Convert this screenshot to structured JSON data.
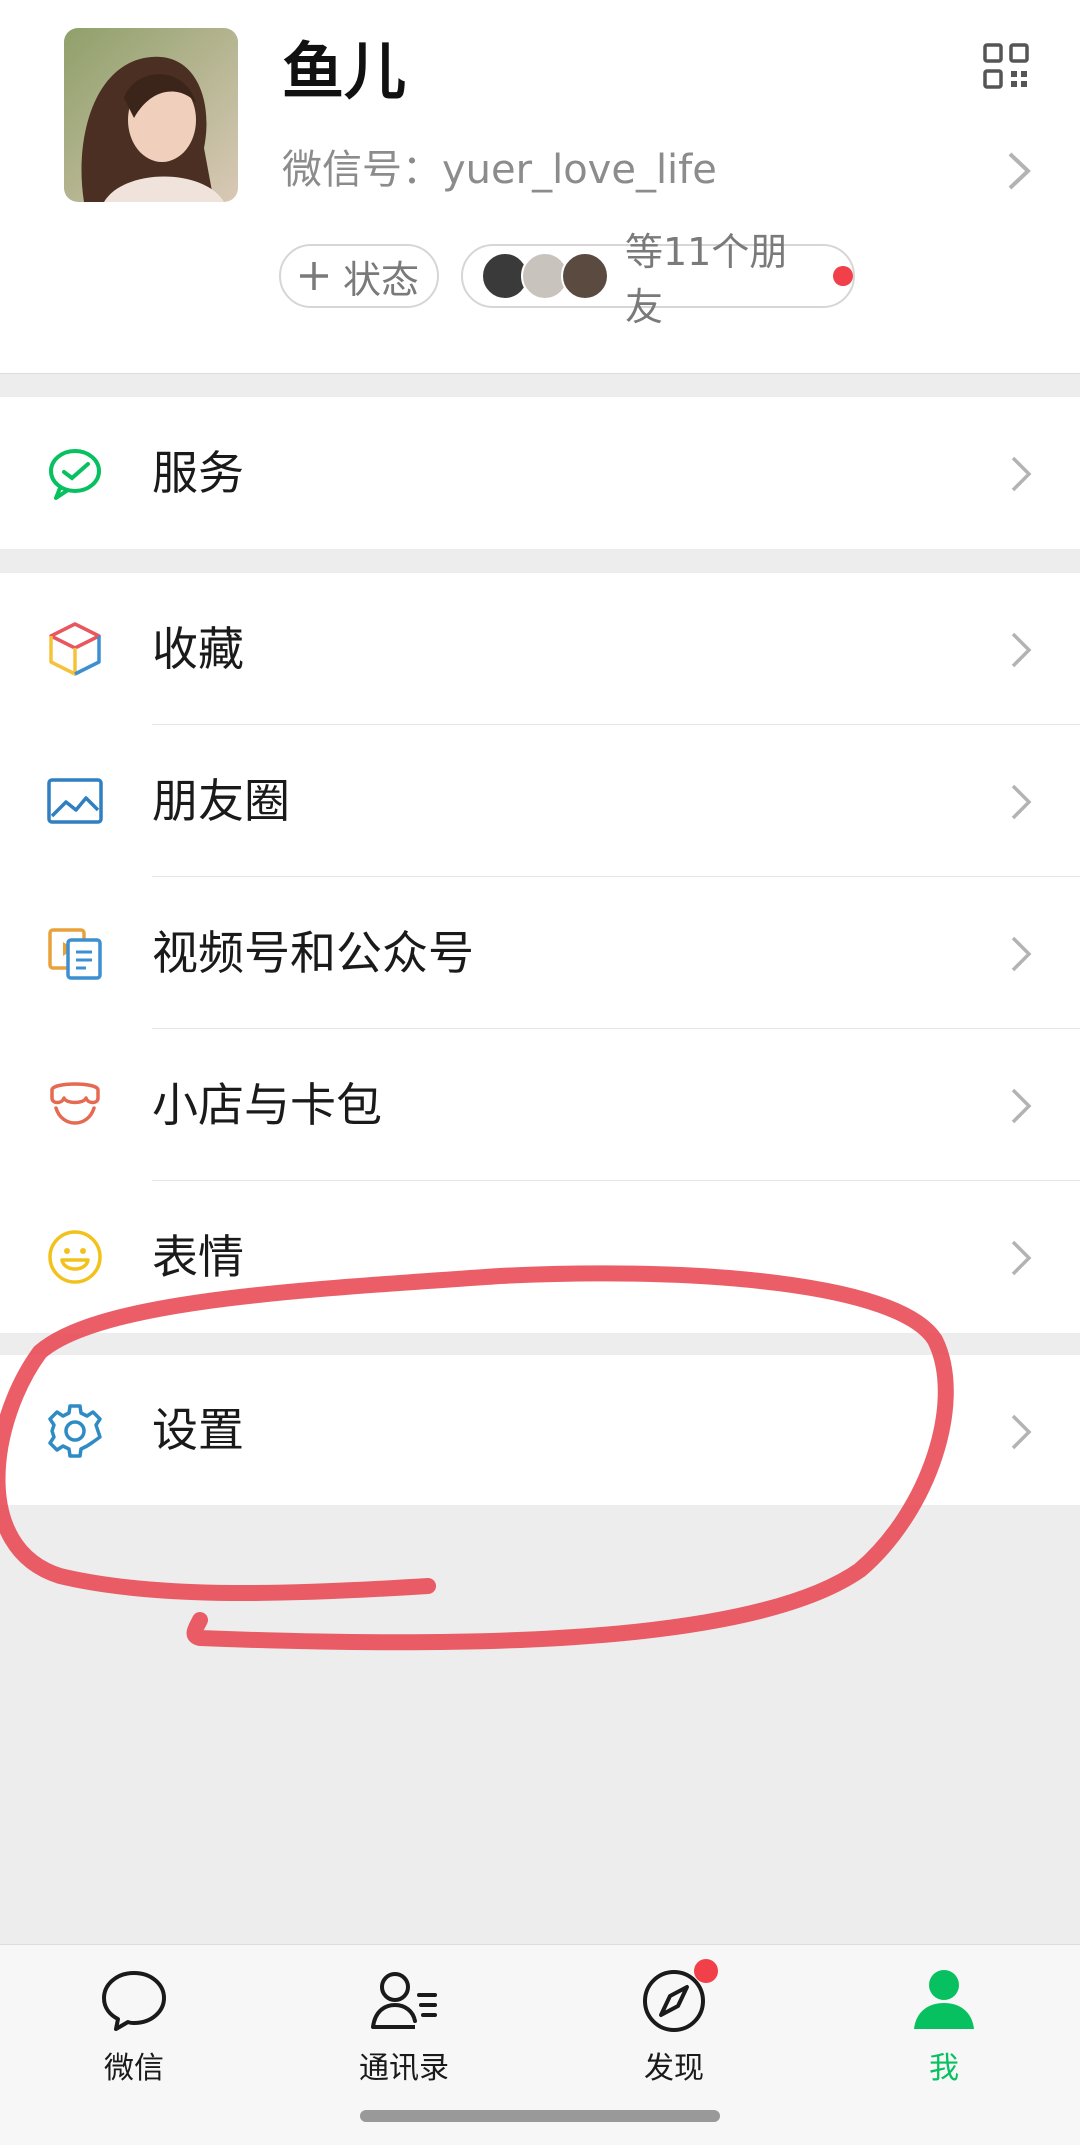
{
  "profile": {
    "name": "鱼儿",
    "wechat_id": "微信号：yuer_love_life",
    "status_button": "状态",
    "friends_text": "等11个朋友"
  },
  "menu": {
    "services": "服务",
    "favorites": "收藏",
    "moments": "朋友圈",
    "channels": "视频号和公众号",
    "shop_cards": "小店与卡包",
    "stickers": "表情",
    "settings": "设置"
  },
  "tabs": [
    {
      "label": "微信",
      "icon": "chat-bubble-icon"
    },
    {
      "label": "通讯录",
      "icon": "contacts-icon"
    },
    {
      "label": "发现",
      "icon": "compass-icon",
      "badge": true
    },
    {
      "label": "我",
      "icon": "person-icon",
      "active": true
    }
  ],
  "colors": {
    "accent_green": "#07c160",
    "badge_red": "#f2404a",
    "annotation_red": "#e8424e"
  }
}
